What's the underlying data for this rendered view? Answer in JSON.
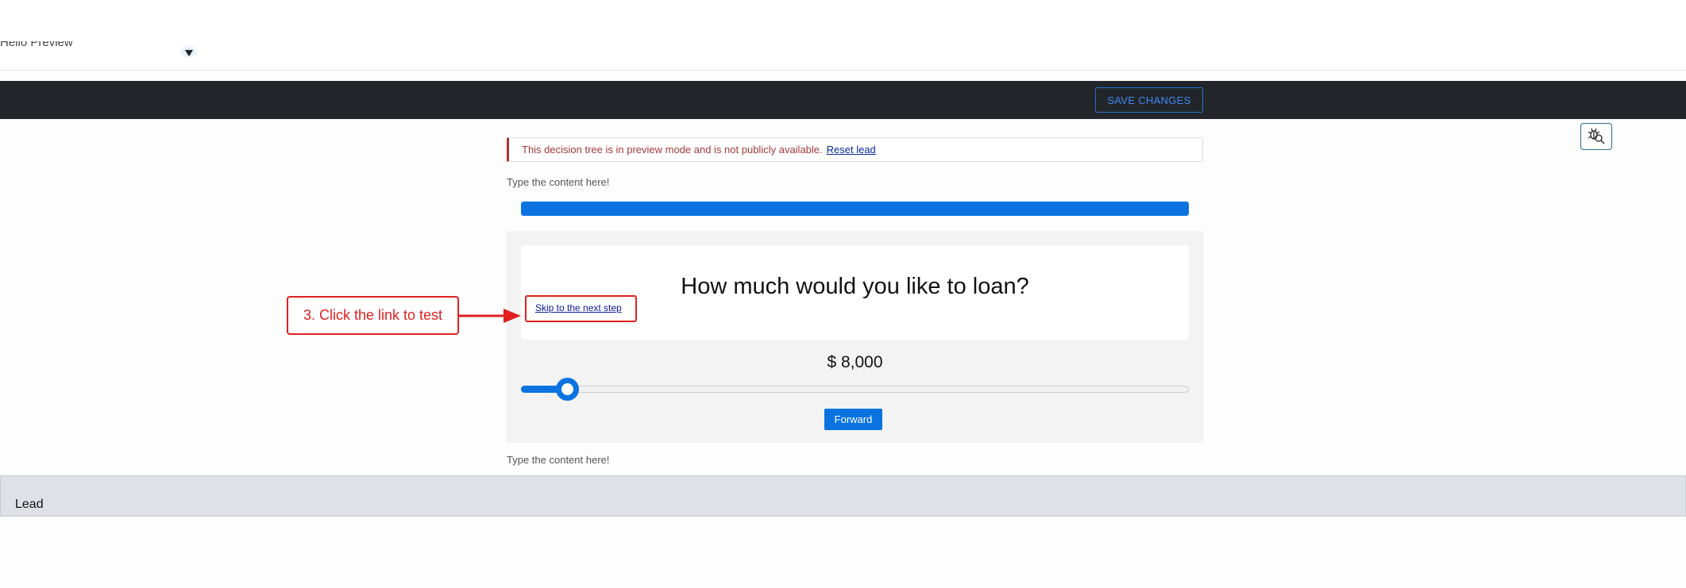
{
  "header": {
    "cut_off_label": "Hello Preview",
    "save_button": "SAVE CHANGES"
  },
  "alert": {
    "message": "This decision tree is in preview mode and is not publicly available.",
    "reset_link": "Reset lead",
    "accent_color": "#b03030"
  },
  "content": {
    "top_placeholder": "Type the content here!",
    "bottom_placeholder": "Type the content here!"
  },
  "progress": {
    "fraction": 1.0,
    "color": "#0a73e0"
  },
  "question": {
    "title": "How much would you like to loan?",
    "skip_link": "Skip to the next step"
  },
  "loan": {
    "amount_display": "$ 8,000",
    "slider_fraction": 0.069
  },
  "actions": {
    "forward_label": "Forward"
  },
  "annotation": {
    "text": "3. Click the link to test",
    "color": "#e02020"
  },
  "footer": {
    "lead_label": "Lead"
  },
  "icons": {
    "floating": "bug-search-icon",
    "dropdown": "chevron-down-icon",
    "arrow": "arrow-right-icon"
  }
}
